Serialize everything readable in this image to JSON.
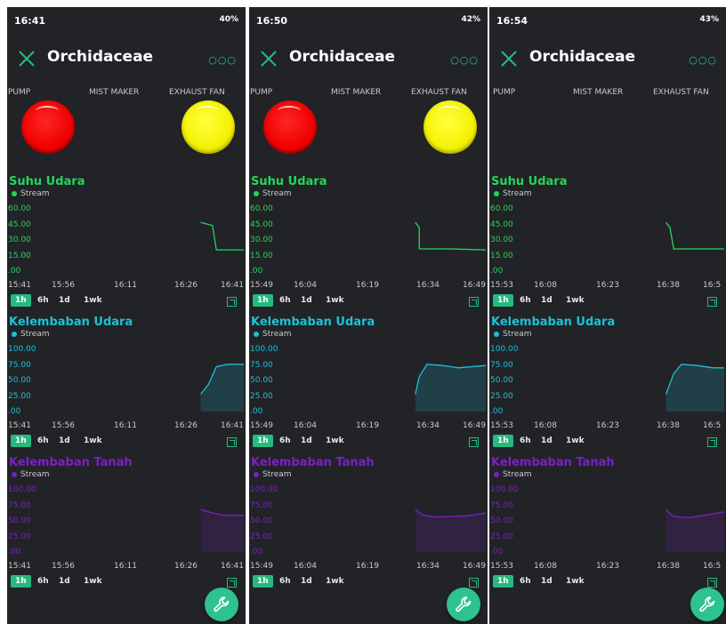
{
  "panels": [
    {
      "time": "16:41",
      "battery": "40%",
      "title": "Orchidaceae",
      "labels": [
        "PUMP",
        "MIST MAKER",
        "EXHAUST FAN"
      ],
      "leds": {
        "pump": "red",
        "exhaust": "yellow"
      },
      "charts": [
        {
          "title": "Suhu Udara",
          "legend": "Stream",
          "yticks": [
            "60.00",
            "45.00",
            "30.00",
            "15.00",
            ".00"
          ],
          "xticks": [
            "15:41",
            "15:56",
            "16:11",
            "16:26",
            "16:41"
          ],
          "series": [
            {
              "name": "Stream",
              "color": "#24d65a",
              "points": [
                [
                  16.3,
                  47
                ],
                [
                  16.33,
                  44
                ],
                [
                  16.345,
                  19
                ],
                [
                  16.36,
                  19
                ],
                [
                  16.41,
                  19
                ]
              ]
            }
          ],
          "ylim": [
            0,
            60
          ]
        },
        {
          "title": "Kelembaban Udara",
          "legend": "Stream",
          "yticks": [
            "100.00",
            "75.00",
            "50.00",
            "25.00",
            ".00"
          ],
          "xticks": [
            "15:41",
            "15:56",
            "16:11",
            "16:26",
            "16:41"
          ],
          "series": [
            {
              "name": "Stream",
              "color": "#1ec0d6",
              "points": [
                [
                  16.3,
                  25
                ],
                [
                  16.32,
                  42
                ],
                [
                  16.345,
                  72
                ],
                [
                  16.37,
                  76
                ],
                [
                  16.41,
                  76
                ]
              ]
            }
          ],
          "ylim": [
            0,
            100
          ]
        },
        {
          "title": "Kelembaban Tanah",
          "legend": "Stream",
          "yticks": [
            "100.00",
            "75.00",
            "50.00",
            "25.00",
            ".00"
          ],
          "xticks": [
            "15:41",
            "15:56",
            "16:11",
            "16:26",
            "16:41"
          ],
          "series": [
            {
              "name": "Stream",
              "color": "#7b20c4",
              "points": [
                [
                  16.3,
                  68
                ],
                [
                  16.33,
                  62
                ],
                [
                  16.355,
                  58
                ],
                [
                  16.38,
                  58
                ],
                [
                  16.41,
                  58
                ]
              ]
            }
          ],
          "ylim": [
            0,
            100
          ]
        }
      ],
      "ranges": [
        "1h",
        "6h",
        "1d",
        "1wk"
      ],
      "active_range": "1h"
    },
    {
      "time": "16:50",
      "battery": "42%",
      "title": "Orchidaceae",
      "labels": [
        "PUMP",
        "MIST MAKER",
        "EXHAUST FAN"
      ],
      "leds": {
        "pump": "red",
        "exhaust": "yellow"
      },
      "charts": [
        {
          "title": "Suhu Udara",
          "legend": "Stream",
          "yticks": [
            "60.00",
            "45.00",
            "30.00",
            "15.00",
            ".00"
          ],
          "xticks": [
            "15:49",
            "16:04",
            "16:19",
            "16:34",
            "16:49"
          ],
          "series": [
            {
              "name": "Stream",
              "color": "#24d65a",
              "points": [
                [
                  16.31,
                  47
                ],
                [
                  16.32,
                  42
                ],
                [
                  16.325,
                  20
                ],
                [
                  16.4,
                  20
                ],
                [
                  16.49,
                  19
                ]
              ]
            }
          ],
          "ylim": [
            0,
            60
          ]
        },
        {
          "title": "Kelembaban Udara",
          "legend": "Stream",
          "yticks": [
            "100.00",
            "75.00",
            "50.00",
            "25.00",
            ".00"
          ],
          "xticks": [
            "15:49",
            "16:04",
            "16:19",
            "16:34",
            "16:49"
          ],
          "series": [
            {
              "name": "Stream",
              "color": "#1ec0d6",
              "points": [
                [
                  16.31,
                  25
                ],
                [
                  16.325,
                  55
                ],
                [
                  16.345,
                  76
                ],
                [
                  16.38,
                  74
                ],
                [
                  16.42,
                  70
                ],
                [
                  16.49,
                  74
                ]
              ]
            }
          ],
          "ylim": [
            0,
            100
          ]
        },
        {
          "title": "Kelembaban Tanah",
          "legend": "Stream",
          "yticks": [
            "100.00",
            "75.00",
            "50.00",
            "25.00",
            ".00"
          ],
          "xticks": [
            "15:49",
            "16:04",
            "16:19",
            "16:34",
            "16:49"
          ],
          "series": [
            {
              "name": "Stream",
              "color": "#7b20c4",
              "points": [
                [
                  16.31,
                  68
                ],
                [
                  16.33,
                  58
                ],
                [
                  16.36,
                  55
                ],
                [
                  16.4,
                  56
                ],
                [
                  16.44,
                  57
                ],
                [
                  16.49,
                  62
                ]
              ]
            }
          ],
          "ylim": [
            0,
            100
          ]
        }
      ],
      "ranges": [
        "1h",
        "6h",
        "1d",
        "1wk"
      ],
      "active_range": "1h"
    },
    {
      "time": "16:54",
      "battery": "43%",
      "title": "Orchidaceae",
      "labels": [
        "PUMP",
        "MIST MAKER",
        "EXHAUST FAN"
      ],
      "leds": {
        "pump": "none",
        "exhaust": "none"
      },
      "charts": [
        {
          "title": "Suhu Udara",
          "legend": "Stream",
          "yticks": [
            "60.00",
            "45.00",
            "30.00",
            "15.00",
            ".00"
          ],
          "xticks": [
            "15:53",
            "16:08",
            "16:23",
            "16:38",
            "16:5"
          ],
          "series": [
            {
              "name": "Stream",
              "color": "#24d65a",
              "points": [
                [
                  16.38,
                  47
                ],
                [
                  16.39,
                  42
                ],
                [
                  16.4,
                  20
                ],
                [
                  16.53,
                  20
                ]
              ]
            }
          ],
          "ylim": [
            0,
            60
          ]
        },
        {
          "title": "Kelembaban Udara",
          "legend": "Stream",
          "yticks": [
            "100.00",
            "75.00",
            "50.00",
            "25.00",
            ".00"
          ],
          "xticks": [
            "15:53",
            "16:08",
            "16:23",
            "16:38",
            "16:5"
          ],
          "series": [
            {
              "name": "Stream",
              "color": "#1ec0d6",
              "points": [
                [
                  16.38,
                  25
                ],
                [
                  16.4,
                  60
                ],
                [
                  16.42,
                  76
                ],
                [
                  16.46,
                  74
                ],
                [
                  16.5,
                  70
                ],
                [
                  16.53,
                  70
                ]
              ]
            }
          ],
          "ylim": [
            0,
            100
          ]
        },
        {
          "title": "Kelembaban Tanah",
          "legend": "Stream",
          "yticks": [
            "100.00",
            "75.00",
            "50.00",
            "25.00",
            ".00"
          ],
          "xticks": [
            "15:53",
            "16:08",
            "16:23",
            "16:38",
            "16:5"
          ],
          "series": [
            {
              "name": "Stream",
              "color": "#7b20c4",
              "points": [
                [
                  16.38,
                  68
                ],
                [
                  16.4,
                  56
                ],
                [
                  16.44,
                  54
                ],
                [
                  16.48,
                  58
                ],
                [
                  16.53,
                  64
                ]
              ]
            }
          ],
          "ylim": [
            0,
            100
          ]
        }
      ],
      "ranges": [
        "1h",
        "6h",
        "1d",
        "1wk"
      ],
      "active_range": "1h"
    }
  ],
  "colors": {
    "green": "#24d65a",
    "cyan": "#1ec0d6",
    "purple": "#7b20c4",
    "accent": "#26b981",
    "background": "#222327"
  }
}
